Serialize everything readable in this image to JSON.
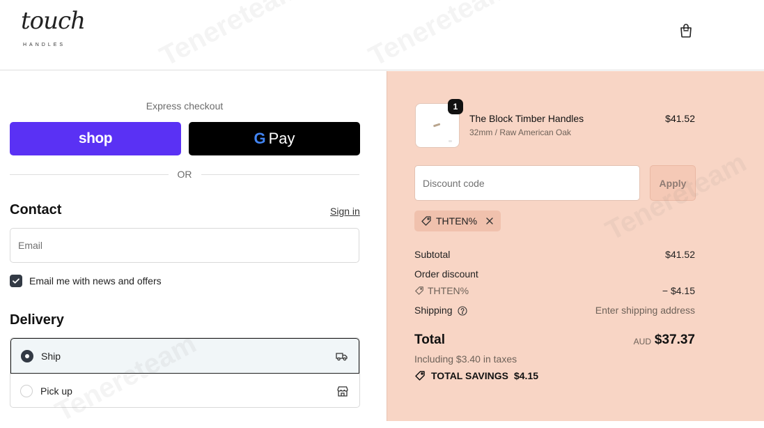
{
  "header": {
    "logo_text": "touch",
    "logo_subtext": "HANDLES",
    "cart_icon": "shopping-bag-icon"
  },
  "express": {
    "label": "Express checkout",
    "shop_label": "shop",
    "gpay_g": "G",
    "gpay_label": "Pay",
    "or_label": "OR"
  },
  "contact": {
    "title": "Contact",
    "signin_label": "Sign in",
    "email_placeholder": "Email",
    "newsletter_label": "Email me with news and offers",
    "newsletter_checked": true
  },
  "delivery": {
    "title": "Delivery",
    "options": [
      {
        "label": "Ship",
        "selected": true,
        "icon": "truck-icon"
      },
      {
        "label": "Pick up",
        "selected": false,
        "icon": "store-icon"
      }
    ]
  },
  "order": {
    "item": {
      "quantity": "1",
      "name": "The Block Timber Handles",
      "variant": "32mm / Raw American Oak",
      "price": "$41.52"
    },
    "discount": {
      "placeholder": "Discount code",
      "apply_label": "Apply",
      "applied_code": "THTEN%"
    },
    "summary": {
      "subtotal_label": "Subtotal",
      "subtotal_value": "$41.52",
      "order_discount_label": "Order discount",
      "discount_code": "THTEN%",
      "discount_value": "− $4.15",
      "shipping_label": "Shipping",
      "shipping_value": "Enter shipping address",
      "total_label": "Total",
      "currency": "AUD",
      "total_value": "$37.37",
      "taxes_note": "Including $3.40 in taxes",
      "savings_label": "TOTAL SAVINGS",
      "savings_value": "$4.15"
    }
  },
  "colors": {
    "shop_purple": "#5a31f4",
    "summary_bg": "#f8d5c5",
    "selected_option_bg": "#f1f6f8"
  },
  "watermark": "Tenereteam"
}
